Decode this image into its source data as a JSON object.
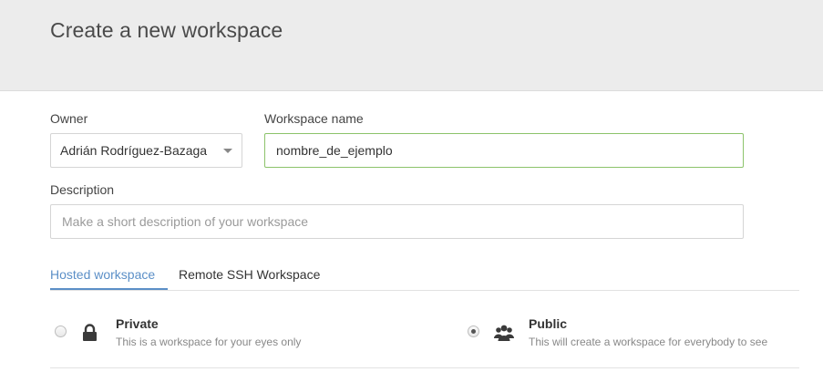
{
  "header": {
    "title": "Create a new workspace"
  },
  "form": {
    "owner": {
      "label": "Owner",
      "selected": "Adrián Rodríguez-Bazaga"
    },
    "workspace_name": {
      "label": "Workspace name",
      "value": "nombre_de_ejemplo"
    },
    "description": {
      "label": "Description",
      "placeholder": "Make a short description of your workspace",
      "value": ""
    }
  },
  "tabs": [
    {
      "label": "Hosted workspace",
      "active": true
    },
    {
      "label": "Remote SSH Workspace",
      "active": false
    }
  ],
  "visibility": {
    "options": [
      {
        "title": "Private",
        "description": "This is a workspace for your eyes only",
        "icon": "lock-icon",
        "selected": false
      },
      {
        "title": "Public",
        "description": "This will create a workspace for everybody to see",
        "icon": "users-icon",
        "selected": true
      }
    ]
  },
  "colors": {
    "accent": "#5b8fc7",
    "focus_border": "#8cc36b",
    "header_bg": "#ececec"
  }
}
